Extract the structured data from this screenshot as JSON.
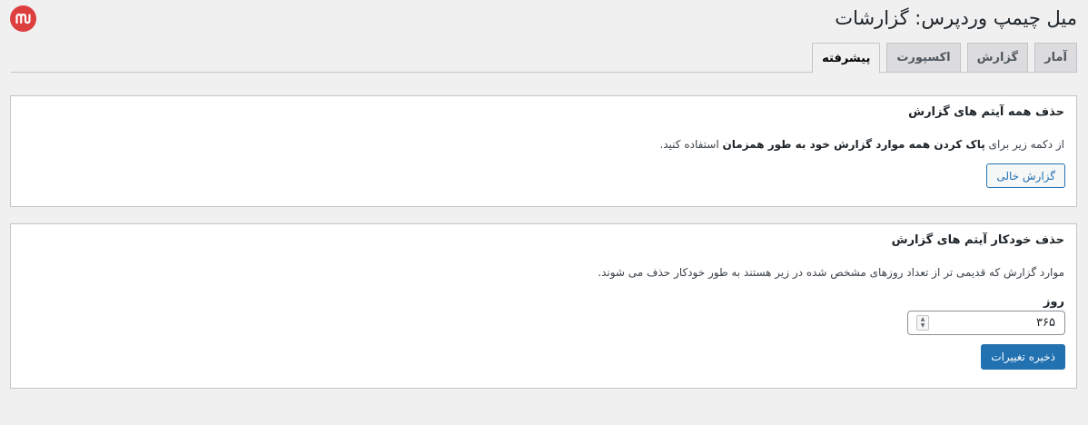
{
  "header": {
    "title": "میل چیمپ وردپرس: گزارشات",
    "logo_icon": "mailchimp-logo-icon"
  },
  "tabs": [
    {
      "label": "آمار",
      "active": false
    },
    {
      "label": "گزارش",
      "active": false
    },
    {
      "label": "اکسپورت",
      "active": false
    },
    {
      "label": "پیشرفته",
      "active": true
    }
  ],
  "clear_section": {
    "title": "حذف همه آیتم های گزارش",
    "desc_before": "از دکمه زیر برای ",
    "desc_bold": "پاک کردن همه موارد گزارش خود به طور همزمان",
    "desc_after": " استفاده کنید.",
    "button_label": "گزارش خالی"
  },
  "auto_section": {
    "title": "حذف خودکار آیتم های گزارش",
    "desc": "موارد گزارش که قدیمی تر از تعداد روزهای مشخص شده در زیر هستند به طور خودکار حذف می شوند.",
    "field_label": "روز",
    "days_value": "۳۶۵",
    "save_label": "ذخیره تغییرات"
  },
  "colors": {
    "accent": "#2271b1",
    "logo": "#dd3e3e",
    "background": "#f0f0f1"
  }
}
